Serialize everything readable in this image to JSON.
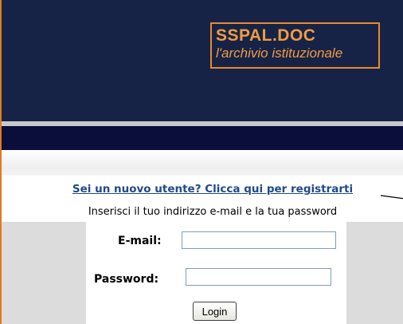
{
  "header": {
    "logo_title": "SSPAL.DOC",
    "logo_subtitle": "l'archivio istituzionale"
  },
  "login": {
    "register_link": "Sei un nuovo utente? Clicca qui per registrarti",
    "instructions": "Inserisci il tuo indirizzo e-mail e la tua password",
    "email_label": "E-mail:",
    "email_value": "",
    "password_label": "Password:",
    "password_value": "",
    "login_button": "Login"
  },
  "colors": {
    "header_bg": "#162346",
    "nav_bar": "#0b0e3a",
    "logo_orange": "#f29b3f",
    "link": "#204a87",
    "side_panel": "#dcdcdc"
  }
}
